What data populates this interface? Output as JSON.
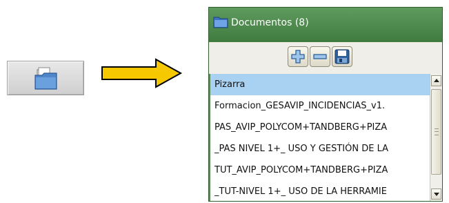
{
  "folder_button": {
    "icon": "folder-open-icon"
  },
  "arrow": {
    "icon": "right-arrow-icon",
    "color": "#f2c200"
  },
  "panel": {
    "title": "Documentos (8)",
    "header_icon": "folder-icon",
    "toolbar": {
      "add_icon": "plus-icon",
      "remove_icon": "minus-icon",
      "save_icon": "floppy-disk-icon"
    },
    "documents": [
      "Pizarra",
      "Formacion_GESAVIP_INCIDENCIAS_v1.",
      "PAS_AVIP_POLYCOM+TANDBERG+PIZA",
      "_PAS NIVEL 1+_ USO Y GESTIÓN DE LA",
      "TUT_AVIP_POLYCOM+TANDBERG+PIZA",
      "_TUT-NIVEL 1+_ USO DE LA HERRAMIE"
    ],
    "selected_index": 0
  }
}
